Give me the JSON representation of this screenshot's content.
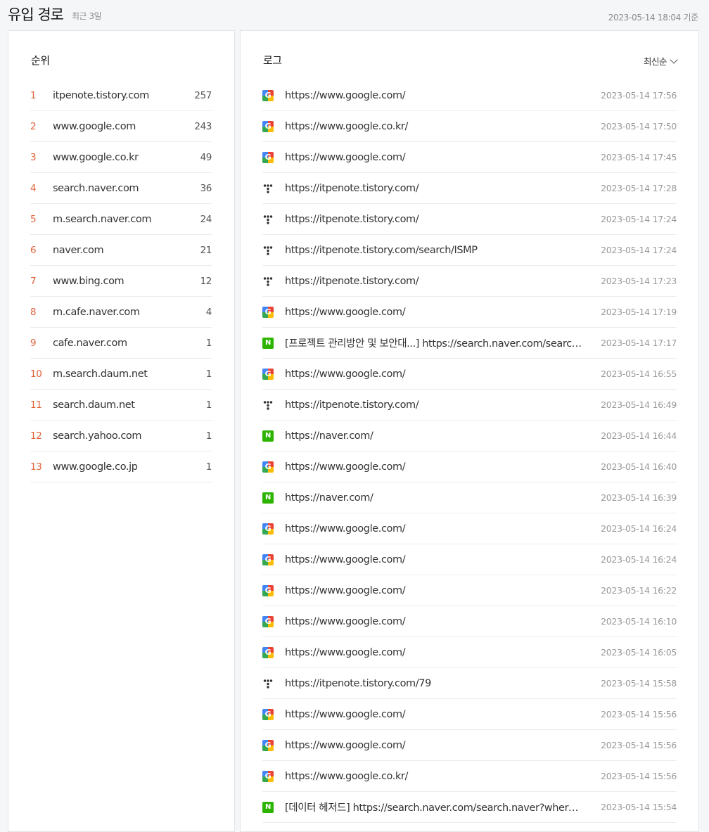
{
  "header": {
    "title": "유입 경로",
    "subtitle": "최근 3일",
    "basis": "2023-05-14 18:04 기준"
  },
  "ranking": {
    "heading": "순위",
    "items": [
      {
        "rank": "1",
        "domain": "itpenote.tistory.com",
        "count": "257"
      },
      {
        "rank": "2",
        "domain": "www.google.com",
        "count": "243"
      },
      {
        "rank": "3",
        "domain": "www.google.co.kr",
        "count": "49"
      },
      {
        "rank": "4",
        "domain": "search.naver.com",
        "count": "36"
      },
      {
        "rank": "5",
        "domain": "m.search.naver.com",
        "count": "24"
      },
      {
        "rank": "6",
        "domain": "naver.com",
        "count": "21"
      },
      {
        "rank": "7",
        "domain": "www.bing.com",
        "count": "12"
      },
      {
        "rank": "8",
        "domain": "m.cafe.naver.com",
        "count": "4"
      },
      {
        "rank": "9",
        "domain": "cafe.naver.com",
        "count": "1"
      },
      {
        "rank": "10",
        "domain": "m.search.daum.net",
        "count": "1"
      },
      {
        "rank": "11",
        "domain": "search.daum.net",
        "count": "1"
      },
      {
        "rank": "12",
        "domain": "search.yahoo.com",
        "count": "1"
      },
      {
        "rank": "13",
        "domain": "www.google.co.jp",
        "count": "1"
      }
    ]
  },
  "log": {
    "heading": "로그",
    "sort_label": "최신순",
    "items": [
      {
        "icon": "google-icon",
        "url": "https://www.google.com/",
        "time": "2023-05-14 17:56"
      },
      {
        "icon": "google-icon",
        "url": "https://www.google.co.kr/",
        "time": "2023-05-14 17:50"
      },
      {
        "icon": "google-icon",
        "url": "https://www.google.com/",
        "time": "2023-05-14 17:45"
      },
      {
        "icon": "tistory-icon",
        "url": "https://itpenote.tistory.com/",
        "time": "2023-05-14 17:28"
      },
      {
        "icon": "tistory-icon",
        "url": "https://itpenote.tistory.com/",
        "time": "2023-05-14 17:24"
      },
      {
        "icon": "tistory-icon",
        "url": "https://itpenote.tistory.com/search/ISMP",
        "time": "2023-05-14 17:24"
      },
      {
        "icon": "tistory-icon",
        "url": "https://itpenote.tistory.com/",
        "time": "2023-05-14 17:23"
      },
      {
        "icon": "google-icon",
        "url": "https://www.google.com/",
        "time": "2023-05-14 17:19"
      },
      {
        "icon": "naver-icon",
        "url": "[프로젝트 관리방안 및 보안대...] https://search.naver.com/search.n…",
        "time": "2023-05-14 17:17"
      },
      {
        "icon": "google-icon",
        "url": "https://www.google.com/",
        "time": "2023-05-14 16:55"
      },
      {
        "icon": "tistory-icon",
        "url": "https://itpenote.tistory.com/",
        "time": "2023-05-14 16:49"
      },
      {
        "icon": "naver-icon",
        "url": "https://naver.com/",
        "time": "2023-05-14 16:44"
      },
      {
        "icon": "google-icon",
        "url": "https://www.google.com/",
        "time": "2023-05-14 16:40"
      },
      {
        "icon": "naver-icon",
        "url": "https://naver.com/",
        "time": "2023-05-14 16:39"
      },
      {
        "icon": "google-icon",
        "url": "https://www.google.com/",
        "time": "2023-05-14 16:24"
      },
      {
        "icon": "google-icon",
        "url": "https://www.google.com/",
        "time": "2023-05-14 16:24"
      },
      {
        "icon": "google-icon",
        "url": "https://www.google.com/",
        "time": "2023-05-14 16:22"
      },
      {
        "icon": "google-icon",
        "url": "https://www.google.com/",
        "time": "2023-05-14 16:10"
      },
      {
        "icon": "google-icon",
        "url": "https://www.google.com/",
        "time": "2023-05-14 16:05"
      },
      {
        "icon": "tistory-icon",
        "url": "https://itpenote.tistory.com/79",
        "time": "2023-05-14 15:58"
      },
      {
        "icon": "google-icon",
        "url": "https://www.google.com/",
        "time": "2023-05-14 15:56"
      },
      {
        "icon": "google-icon",
        "url": "https://www.google.com/",
        "time": "2023-05-14 15:56"
      },
      {
        "icon": "google-icon",
        "url": "https://www.google.co.kr/",
        "time": "2023-05-14 15:56"
      },
      {
        "icon": "naver-icon",
        "url": "[데이터 헤저드] https://search.naver.com/search.naver?where=n…",
        "time": "2023-05-14 15:54"
      }
    ]
  },
  "colors": {
    "rank_number": "#e0623a",
    "naver_green": "#2db400",
    "background": "#f5f6f8"
  }
}
